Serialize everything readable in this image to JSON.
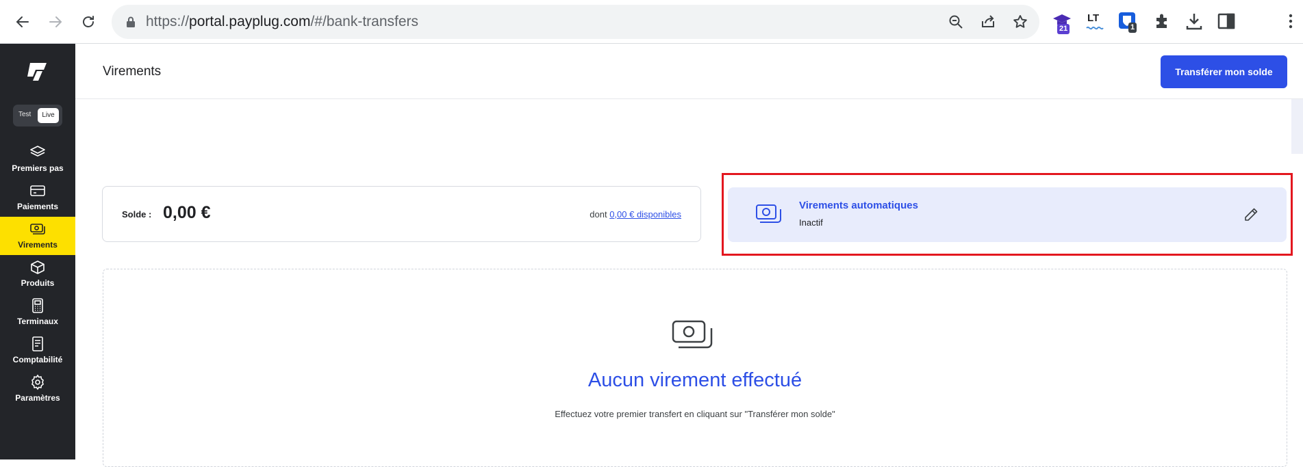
{
  "browser": {
    "url_scheme": "https://",
    "url_host": "portal.payplug.com",
    "url_path": "/#/bank-transfers",
    "extensions": [
      {
        "name": "graduation-cap-extension",
        "badge": "21"
      },
      {
        "name": "languagetool-extension",
        "label": "LT"
      },
      {
        "name": "bitwarden-extension",
        "badge": "1"
      }
    ]
  },
  "sidebar": {
    "mode_switch": {
      "test_label": "Test",
      "live_label": "Live"
    },
    "items": [
      {
        "label": "Premiers pas",
        "icon": "layers-icon"
      },
      {
        "label": "Paiements",
        "icon": "credit-card-icon"
      },
      {
        "label": "Virements",
        "icon": "banknote-icon",
        "active": true
      },
      {
        "label": "Produits",
        "icon": "box-icon"
      },
      {
        "label": "Terminaux",
        "icon": "terminal-icon"
      },
      {
        "label": "Comptabilité",
        "icon": "ledger-icon"
      },
      {
        "label": "Paramètres",
        "icon": "gear-icon"
      }
    ]
  },
  "header": {
    "title": "Virements",
    "transfer_button": "Transférer mon solde"
  },
  "balance": {
    "label": "Solde :",
    "amount": "0,00 €",
    "available_prefix": "dont",
    "available_link": "0,00 € disponibles"
  },
  "auto_transfers": {
    "title": "Virements automatiques",
    "status": "Inactif"
  },
  "empty_state": {
    "title": "Aucun virement effectué",
    "subtitle": "Effectuez votre premier transfert en cliquant sur \"Transférer mon solde\""
  },
  "colors": {
    "accent": "#2d4fe6",
    "sidebar_bg": "#232529",
    "active_item": "#fde000",
    "highlight": "#e3171f",
    "auto_card_bg": "#e8ecfc"
  }
}
